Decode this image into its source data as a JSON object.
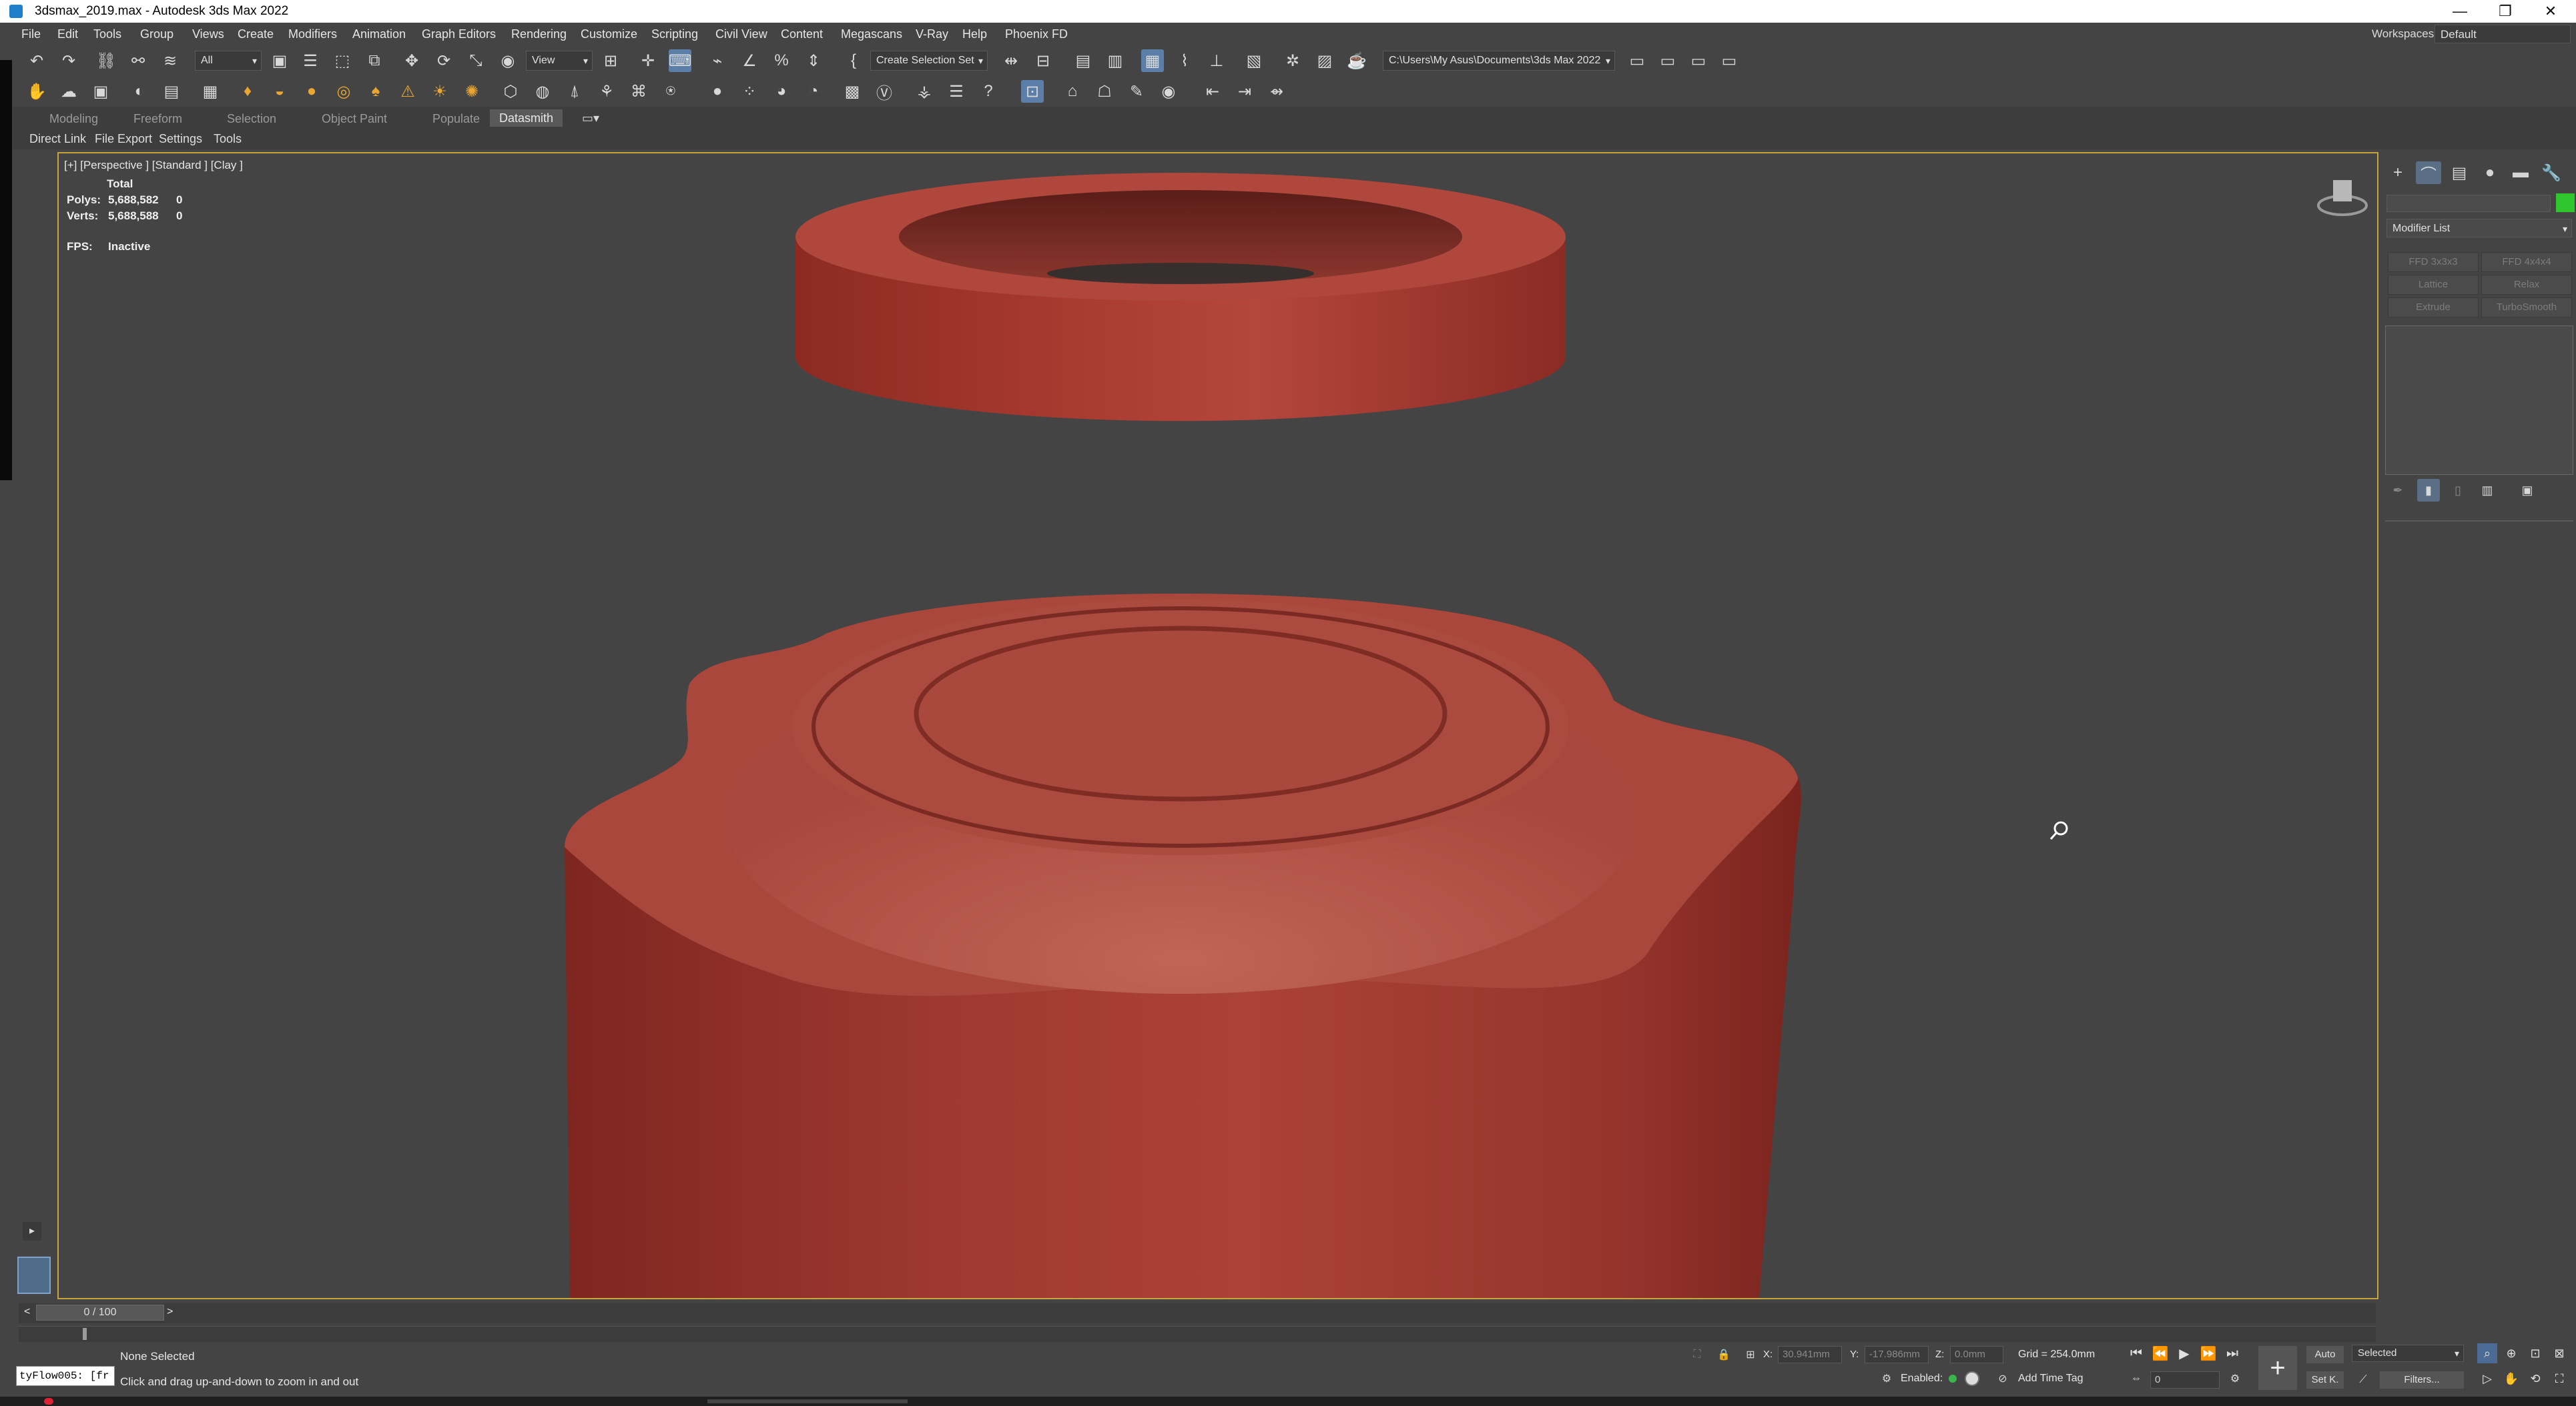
{
  "window": {
    "title": "3dsmax_2019.max - Autodesk 3ds Max 2022",
    "minimize": "—",
    "restore": "❐",
    "close": "✕"
  },
  "menubar": {
    "items": [
      "File",
      "Edit",
      "Tools",
      "Group",
      "Views",
      "Create",
      "Modifiers",
      "Animation",
      "Graph Editors",
      "Rendering",
      "Customize",
      "Scripting",
      "Civil View",
      "Content",
      "Megascans",
      "V-Ray",
      "Help",
      "Phoenix FD"
    ],
    "workspace_label": "Workspaces:",
    "workspace_value": "Default"
  },
  "toolbar": {
    "selection_filter": "All",
    "reference_coord": "View",
    "selection_set": "Create Selection Set",
    "project_path": "C:\\Users\\My Asus\\Documents\\3ds Max 2022"
  },
  "ribbon": {
    "tabs": [
      "Modeling",
      "Freeform",
      "Selection",
      "Object Paint",
      "Populate",
      "Datasmith"
    ],
    "active_tab": "Datasmith",
    "sub_tabs": [
      "Direct Link",
      "File Export",
      "Settings",
      "Tools"
    ]
  },
  "viewport": {
    "label": "[+] [Perspective ] [Standard ] [Clay ]",
    "stats_header": "Total",
    "polys_label": "Polys:",
    "polys_total": "5,688,582",
    "polys_sel": "0",
    "verts_label": "Verts:",
    "verts_total": "5,688,588",
    "verts_sel": "0",
    "fps_label": "FPS:",
    "fps_value": "Inactive",
    "object_color": "#b24a3e",
    "background_color": "#444444"
  },
  "command_panel": {
    "modifier_list": "Modifier List",
    "buttons": [
      "FFD 3x3x3",
      "FFD 4x4x4",
      "Lattice",
      "Relax",
      "Extrude",
      "TurboSmooth"
    ],
    "color_swatch": "#2ec72e"
  },
  "timeline": {
    "frame_display": "0 / 100",
    "prev": "<",
    "next": ">"
  },
  "status": {
    "script_listener": "tyFlow005: [fr",
    "selection_info": "None Selected",
    "prompt": "Click and drag up-and-down to zoom in and out",
    "x_label": "X:",
    "x_value": "30.941mm",
    "y_label": "Y:",
    "y_value": "-17.986mm",
    "z_label": "Z:",
    "z_value": "0.0mm",
    "grid": "Grid = 254.0mm",
    "enabled_label": "Enabled:",
    "add_time_tag": "Add Time Tag",
    "auto": "Auto",
    "set_key": "Set K.",
    "selected_dropdown": "Selected",
    "filters": "Filters...",
    "frame_field": "0"
  }
}
